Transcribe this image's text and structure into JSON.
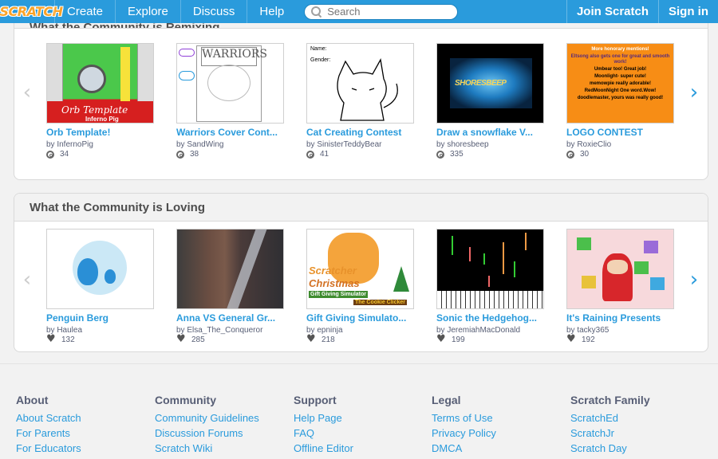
{
  "nav": {
    "logo": "SCRATCH",
    "items": [
      "Create",
      "Explore",
      "Discuss",
      "Help"
    ],
    "search_placeholder": "Search",
    "join": "Join Scratch",
    "signin": "Sign in"
  },
  "remixing": {
    "title": "What the Community is Remixing",
    "projects": [
      {
        "title": "Orb Template!",
        "by": "by InfernoPig",
        "count": "34"
      },
      {
        "title": "Warriors Cover Cont...",
        "by": "by SandWing",
        "count": "38"
      },
      {
        "title": "Cat Creating Contest",
        "by": "by SinisterTeddyBear",
        "count": "41"
      },
      {
        "title": "Draw a snowflake V...",
        "by": "by shoresbeep",
        "count": "335"
      },
      {
        "title": "LOGO CONTEST",
        "by": "by RoxieClio",
        "count": "30"
      }
    ],
    "thumbs": {
      "orb_line1": "Orb Template",
      "orb_line2": "Inferno Pig",
      "warriors": "WARRIORS",
      "cat_name": "Name:",
      "cat_gender": "Gender:",
      "snow": "SHORESBEEP",
      "logo_lines": [
        "More honorary mentions!",
        "Eltsong also gets one for great and smooth work!",
        "Umbear too! Great job!",
        "Moonlight- super cute!",
        "memowpie really adorable!",
        "RedMoonNight One word.Wow!",
        "doodlemaster, yours was really good!"
      ]
    }
  },
  "loving": {
    "title": "What the Community is Loving",
    "projects": [
      {
        "title": "Penguin Berg",
        "by": "by Haulea",
        "count": "132"
      },
      {
        "title": "Anna VS General Gr...",
        "by": "by Elsa_The_Conqueror",
        "count": "285"
      },
      {
        "title": "Gift Giving Simulato...",
        "by": "by epninja",
        "count": "218"
      },
      {
        "title": "Sonic the Hedgehog...",
        "by": "by JeremiahMacDonald",
        "count": "199"
      },
      {
        "title": "It's Raining Presents",
        "by": "by tacky365",
        "count": "192"
      }
    ],
    "thumbs": {
      "xmas1": "Scratcher",
      "xmas2": "Christmas",
      "xmas3": "Gift Giving Simulator",
      "xmas4": "The Cookie Clicker"
    }
  },
  "footer": {
    "cols": [
      {
        "heading": "About",
        "links": [
          "About Scratch",
          "For Parents",
          "For Educators"
        ]
      },
      {
        "heading": "Community",
        "links": [
          "Community Guidelines",
          "Discussion Forums",
          "Scratch Wiki"
        ]
      },
      {
        "heading": "Support",
        "links": [
          "Help Page",
          "FAQ",
          "Offline Editor"
        ]
      },
      {
        "heading": "Legal",
        "links": [
          "Terms of Use",
          "Privacy Policy",
          "DMCA"
        ]
      },
      {
        "heading": "Scratch Family",
        "links": [
          "ScratchEd",
          "ScratchJr",
          "Scratch Day"
        ]
      }
    ]
  },
  "colors": {
    "nav": "#2a9bdc",
    "link": "#2a9bdc",
    "logo": "#f9a227"
  },
  "icons": {
    "remix": "remix-icon",
    "love": "heart-icon",
    "search": "search-icon"
  }
}
